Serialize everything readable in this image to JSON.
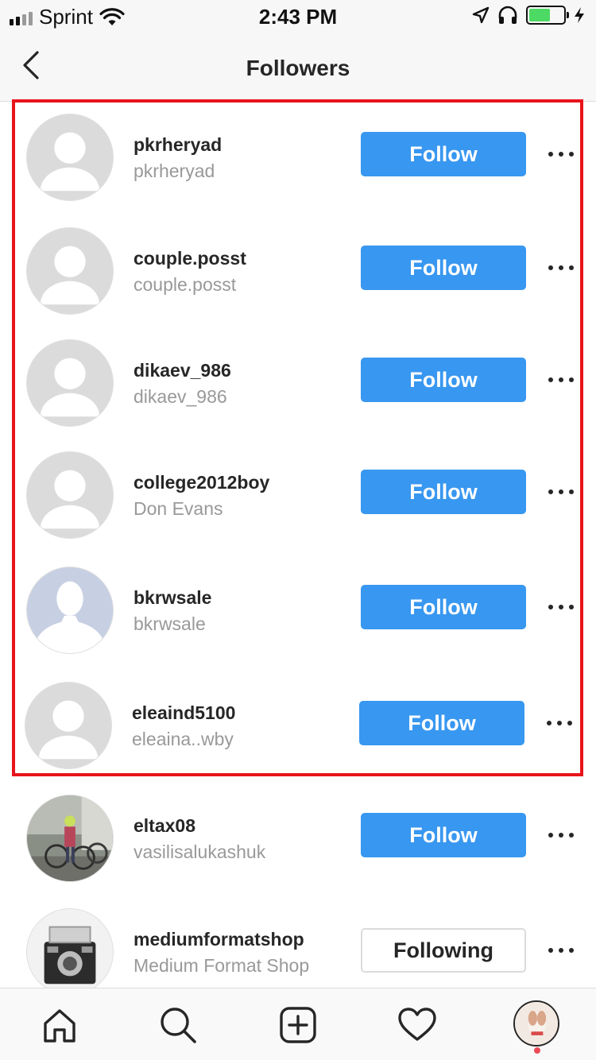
{
  "status_bar": {
    "carrier": "Sprint",
    "time": "2:43 PM",
    "battery_color": "#4cd964"
  },
  "header": {
    "title": "Followers",
    "back_icon": "chevron-left-icon"
  },
  "followers": [
    {
      "username": "pkrheryad",
      "full_name": "pkrheryad",
      "button": "Follow",
      "avatar": "default-gray"
    },
    {
      "username": "couple.posst",
      "full_name": "couple.posst",
      "button": "Follow",
      "avatar": "default-gray"
    },
    {
      "username": "dikaev_986",
      "full_name": "dikaev_986",
      "button": "Follow",
      "avatar": "default-gray"
    },
    {
      "username": "college2012boy",
      "full_name": "Don Evans",
      "button": "Follow",
      "avatar": "default-gray"
    },
    {
      "username": "bkrwsale",
      "full_name": "bkrwsale",
      "button": "Follow",
      "avatar": "default-blue-silhouette"
    },
    {
      "username": "eleaind5100",
      "full_name": "eleaina..wby",
      "button": "Follow",
      "avatar": "default-gray"
    },
    {
      "username": "eltax08",
      "full_name": "vasilisalukashuk",
      "button": "Follow",
      "avatar": "photo-bicycles"
    },
    {
      "username": "mediumformatshop",
      "full_name": "Medium Format Shop",
      "button": "Following",
      "avatar": "photo-camera"
    }
  ],
  "tab_bar": {
    "items": [
      "home-icon",
      "search-icon",
      "new-post-icon",
      "activity-heart-icon",
      "profile-avatar"
    ]
  },
  "colors": {
    "follow_button": "#3897f0",
    "highlight_border": "#e8141b",
    "secondary_text": "#999999",
    "notification_dot": "#ed4956"
  }
}
